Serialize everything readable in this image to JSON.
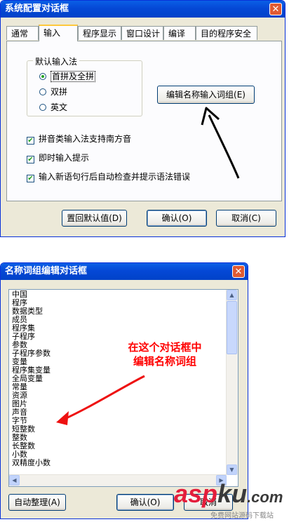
{
  "dialog1": {
    "title": "系统配置对话框",
    "close_glyph": "✕",
    "tabs": [
      "通常",
      "输入",
      "程序显示",
      "窗口设计",
      "编译",
      "目的程序安全"
    ],
    "active_tab": "输入",
    "input_group_title": "默认输入法",
    "radios": [
      {
        "label": "首拼及全拼",
        "selected": true
      },
      {
        "label": "双拼",
        "selected": false
      },
      {
        "label": "英文",
        "selected": false
      }
    ],
    "edit_words_button": "编辑名称输入词组(E)",
    "checks": [
      {
        "label": "拼音类输入法支持南方音",
        "checked": true
      },
      {
        "label": "即时输入提示",
        "checked": true
      },
      {
        "label": "输入新语句行后自动检查并提示语法错误",
        "checked": true
      }
    ],
    "buttons": {
      "restore_default": "置回默认值(D)",
      "ok": "确认(O)",
      "cancel": "取消(C)"
    }
  },
  "dialog2": {
    "title": "名称词组编辑对话框",
    "close_glyph": "✕",
    "items": [
      "中国",
      "程序",
      "数据类型",
      "成员",
      "程序集",
      "子程序",
      "参数",
      "子程序参数",
      "变量",
      "程序集变量",
      "全局变量",
      "常量",
      "资源",
      "图片",
      "声音",
      "字节",
      "短整数",
      "整数",
      "长整数",
      "小数",
      "双精度小数"
    ],
    "buttons": {
      "auto_sort": "自动整理(A)",
      "ok": "确认(O)",
      "cancel": "取消"
    }
  },
  "annotation": {
    "line1": "在这个对话框中",
    "line2": "编辑名称词组",
    "color": "#ff0000"
  },
  "watermark": {
    "asp": "asp",
    "ku": "ku",
    "suffix": ".com",
    "subtitle": "免费网站源码下载站"
  },
  "colors": {
    "xp_title_blue": "#0548d6",
    "dialog_face": "#ece9d8",
    "close_red": "#e05a33"
  }
}
